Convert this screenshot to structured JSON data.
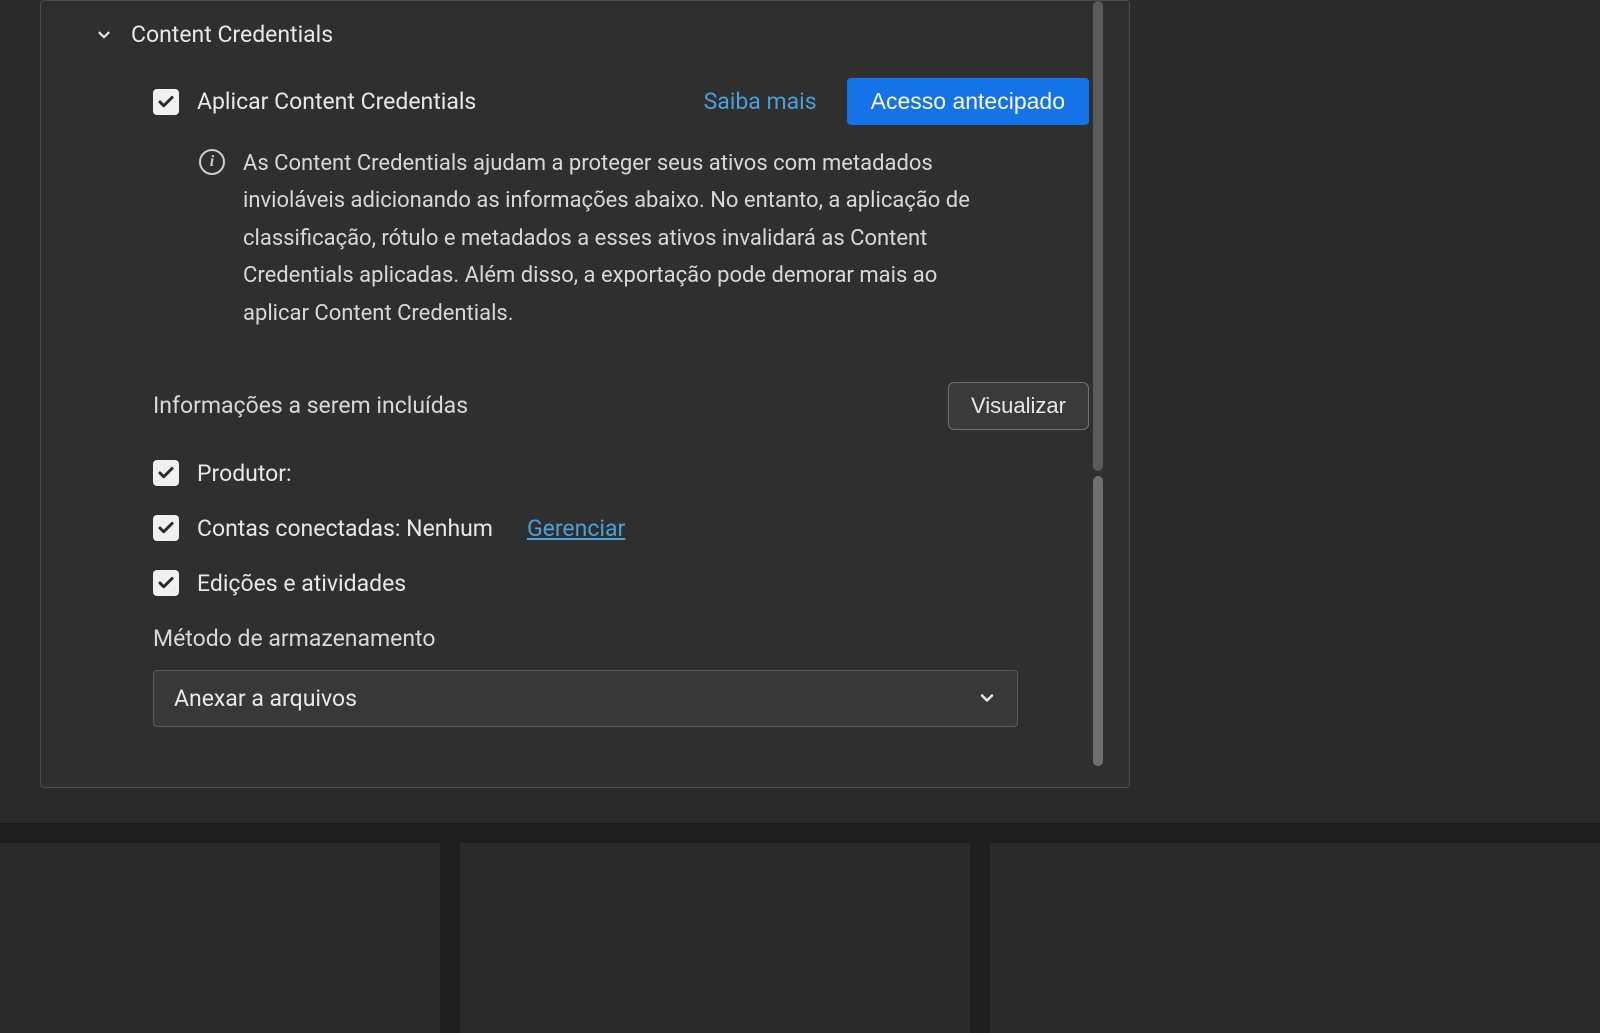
{
  "section": {
    "title": "Content Credentials",
    "apply": {
      "label": "Aplicar Content Credentials",
      "learn_more": "Saiba mais",
      "early_access": "Acesso antecipado"
    },
    "info_text": "As Content Credentials ajudam a proteger seus ativos com metadados invioláveis adicionando as informações abaixo. No entanto, a aplicação de classificação, rótulo e metadados a esses ativos invalidará as Content Credentials aplicadas. Além disso, a exportação pode demorar mais ao aplicar Content Credentials.",
    "include": {
      "header": "Informações a serem incluídas",
      "visualize": "Visualizar",
      "producer": "Produtor:",
      "connected_accounts": "Contas conectadas: Nenhum",
      "manage": "Gerenciar ",
      "edits": "Edições e atividades"
    },
    "storage": {
      "label": "Método de armazenamento",
      "selected": "Anexar a arquivos"
    }
  }
}
